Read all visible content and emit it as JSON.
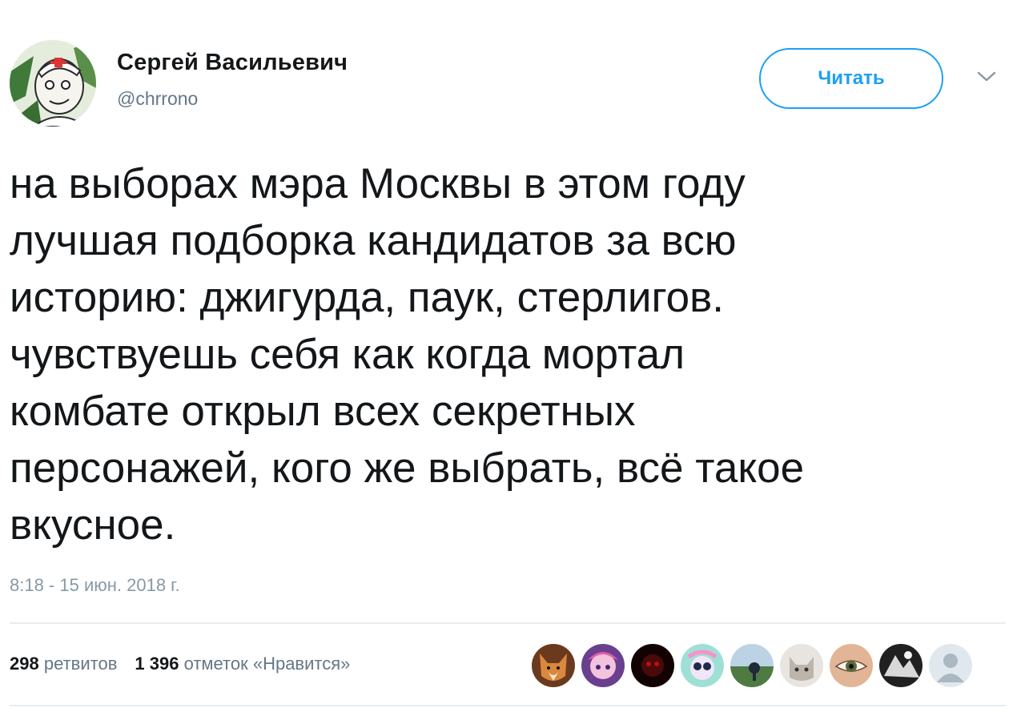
{
  "user": {
    "display_name": "Сергей Васильевич",
    "handle": "@chrrono",
    "avatar_icon": "avatar-icon"
  },
  "follow_button": {
    "label": "Читать",
    "color": "#1da1f2"
  },
  "menu_icon": "chevron-down-icon",
  "tweet": {
    "lines": [
      "на выборах мэра Москвы в этом году",
      "лучшая подборка кандидатов за всю",
      "историю: джигурда, паук, стерлигов.",
      "чувствуешь себя как когда мортал",
      "комбате открыл всех секретных",
      "персонажей, кого же выбрать, всё такое",
      "вкусное."
    ],
    "timestamp": "8:18 - 15 июн. 2018 г."
  },
  "stats": {
    "retweets_count": "298",
    "retweets_label": "ретвитов",
    "likes_count": "1 396",
    "likes_label": "отметок «Нравится»"
  },
  "likers": [
    {
      "icon": "fox-avatar-icon",
      "color": "#b8743a"
    },
    {
      "icon": "anime-avatar-icon",
      "color": "#d58ab8"
    },
    {
      "icon": "dark-red-avatar-icon",
      "color": "#2a0505"
    },
    {
      "icon": "cartoon-avatar-icon",
      "color": "#7fd3c8"
    },
    {
      "icon": "landscape-avatar-icon",
      "color": "#4f7a42"
    },
    {
      "icon": "cat-avatar-icon",
      "color": "#d9d4ce"
    },
    {
      "icon": "eye-avatar-icon",
      "color": "#d6a98c"
    },
    {
      "icon": "bw-avatar-icon",
      "color": "#2c2c2c"
    },
    {
      "icon": "default-user-icon",
      "color": "#cdd5dc"
    }
  ]
}
